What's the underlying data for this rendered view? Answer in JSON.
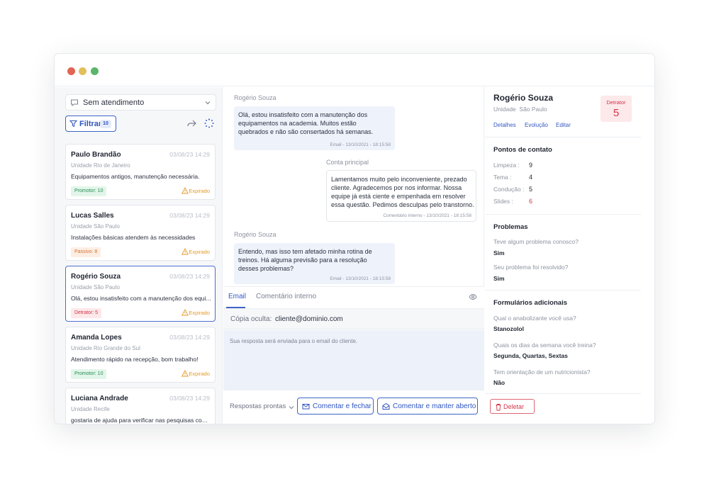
{
  "window": {
    "controls": [
      "close",
      "minimize",
      "maximize"
    ]
  },
  "sidebar": {
    "status_select": {
      "label": "Sem atendimento",
      "icon": "chat-icon"
    },
    "filter": {
      "label": "Filtrar",
      "count": "10"
    },
    "cards": [
      {
        "name": "Paulo Brandão",
        "date": "03/08/23 14:29",
        "unit": "Unidade Rio de Janeiro",
        "message": "Equipamentos antigos, manutenção necessária.",
        "badge": "Promotor: 10",
        "badge_type": "promotor",
        "status": "Expirado"
      },
      {
        "name": "Lucas Salles",
        "date": "03/08/23 14:29",
        "unit": "Unidade São Paulo",
        "message": "Instalações básicas atendem às necessidades",
        "badge": "Passivo: 8",
        "badge_type": "passivo",
        "status": "Expirado"
      },
      {
        "name": "Rogério Souza",
        "date": "03/08/23 14:29",
        "unit": "Unidade São Paulo",
        "message": "Olá, estou insatisfeito com a manutenção dos equi...",
        "badge": "Detrator: 5",
        "badge_type": "detrator",
        "status": "Expirado"
      },
      {
        "name": "Amanda Lopes",
        "date": "03/08/23 14:29",
        "unit": "Unidade Rio Grande do Sul",
        "message": "Atendimento rápido na recepção, bom trabalho!",
        "badge": "Promotor: 10",
        "badge_type": "promotor",
        "status": "Expirado"
      },
      {
        "name": "Luciana Andrade",
        "date": "03/08/23 14:29",
        "unit": "Unidade Recife",
        "message": "gostaria de ajuda para verificar nas pesquisas como ...",
        "badge": "",
        "badge_type": "",
        "status": ""
      }
    ]
  },
  "conversation": {
    "messages": [
      {
        "sender": "Rogério Souza",
        "lines": [
          "Olá, estou insatisfeito com a manutenção dos",
          "equipamentos na academia. Muitos estão",
          "quebrados e não são consertados há semanas."
        ],
        "meta": "Email - 13/10/2021 - 18:15:58"
      },
      {
        "sender": "Conta principal",
        "lines": [
          "Lamentamos muito pelo inconveniente, prezado",
          "cliente. Agradecemos por nos informar. Nossa",
          "equipe já está ciente e empenhada em resolver",
          "essa questão. Pedimos desculpas pelo transtorno."
        ],
        "meta": "Comentário interno - 13/10/2021 - 18:15:58"
      },
      {
        "sender": "Rogério Souza",
        "lines": [
          "Entendo, mas isso tem afetado minha rotina de",
          "treinos. Há alguma previsão para a resolução",
          "desses problemas?"
        ],
        "meta": "Email - 13/10/2021 - 18:15:58"
      }
    ],
    "reply": {
      "tabs": [
        "Email",
        "Comentário interno"
      ],
      "cc_label": "Cópia oculta:",
      "cc_value": "cliente@dominio.com",
      "placeholder": "Sua resposta será enviada para o email do cliente.",
      "quick_replies": "Respostas prontas",
      "btn_close": "Comentar e fechar",
      "btn_keep": "Comentar e manter aberto"
    }
  },
  "details": {
    "name": "Rogério Souza",
    "unit_label": "Unidade",
    "unit_value": "São Paulo",
    "links": [
      "Detalhes",
      "Evolução",
      "Editar"
    ],
    "score_label": "Detrator",
    "score_value": "5",
    "contact_title": "Pontos de contato",
    "contact": [
      {
        "k": "Limpeza :",
        "v": "9",
        "color": "#1f2430"
      },
      {
        "k": "Tema :",
        "v": "4",
        "color": "#1f2430"
      },
      {
        "k": "Condução :",
        "v": "5",
        "color": "#1f2430"
      },
      {
        "k": "Slides :",
        "v": "6",
        "color": "#d3354a"
      }
    ],
    "problems_title": "Problemas",
    "problems": [
      {
        "q": "Teve algum problema conosco?",
        "a": "Sim"
      },
      {
        "q": "Seu problema foi resolvido?",
        "a": "Sim"
      }
    ],
    "forms_title": "Formulários adicionais",
    "forms": [
      {
        "q": "Qual o anabolizante você usa?",
        "a": "Stanozolol"
      },
      {
        "q": "Quais os dias da semana você treina?",
        "a": "Segunda, Quartas, Sextas"
      },
      {
        "q": "Tem orientação de um nutricionista?",
        "a": "Não"
      }
    ],
    "delete_label": "Deletar"
  },
  "colors": {
    "accent": "#3f64c8",
    "danger": "#d3354a",
    "promotor": "#2a8f55",
    "passivo": "#d07232",
    "warning": "#e39b2b"
  }
}
